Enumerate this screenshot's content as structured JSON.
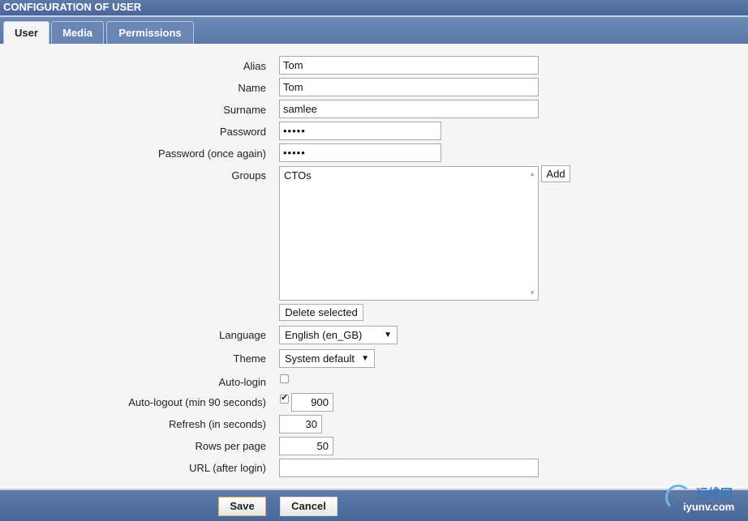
{
  "header": {
    "title": "CONFIGURATION OF USER"
  },
  "tabs": [
    {
      "label": "User",
      "active": true
    },
    {
      "label": "Media",
      "active": false
    },
    {
      "label": "Permissions",
      "active": false
    }
  ],
  "form": {
    "alias": {
      "label": "Alias",
      "value": "Tom"
    },
    "name": {
      "label": "Name",
      "value": "Tom"
    },
    "surname": {
      "label": "Surname",
      "value": "samlee"
    },
    "password": {
      "label": "Password",
      "value": "•••••"
    },
    "password_again": {
      "label": "Password (once again)",
      "value": "•••••"
    },
    "groups": {
      "label": "Groups",
      "items": [
        "CTOs"
      ],
      "add_label": "Add",
      "delete_label": "Delete selected"
    },
    "language": {
      "label": "Language",
      "value": "English (en_GB)"
    },
    "theme": {
      "label": "Theme",
      "value": "System default"
    },
    "autologin": {
      "label": "Auto-login",
      "checked": false
    },
    "autologout": {
      "label": "Auto-logout (min 90 seconds)",
      "checked": true,
      "value": "900"
    },
    "refresh": {
      "label": "Refresh (in seconds)",
      "value": "30"
    },
    "rows": {
      "label": "Rows per page",
      "value": "50"
    },
    "url": {
      "label": "URL (after login)",
      "value": ""
    }
  },
  "footer": {
    "save_label": "Save",
    "cancel_label": "Cancel"
  },
  "watermark": {
    "cn": "运维网",
    "en": "iyunv.com"
  },
  "icons": {
    "dropdown": "▼",
    "scroll_up": "▲",
    "scroll_down": "▼",
    "check": "✔"
  },
  "colors": {
    "header": "#4a679a",
    "tab_bg": "#6a86b4",
    "save_border": "#e2a870"
  }
}
